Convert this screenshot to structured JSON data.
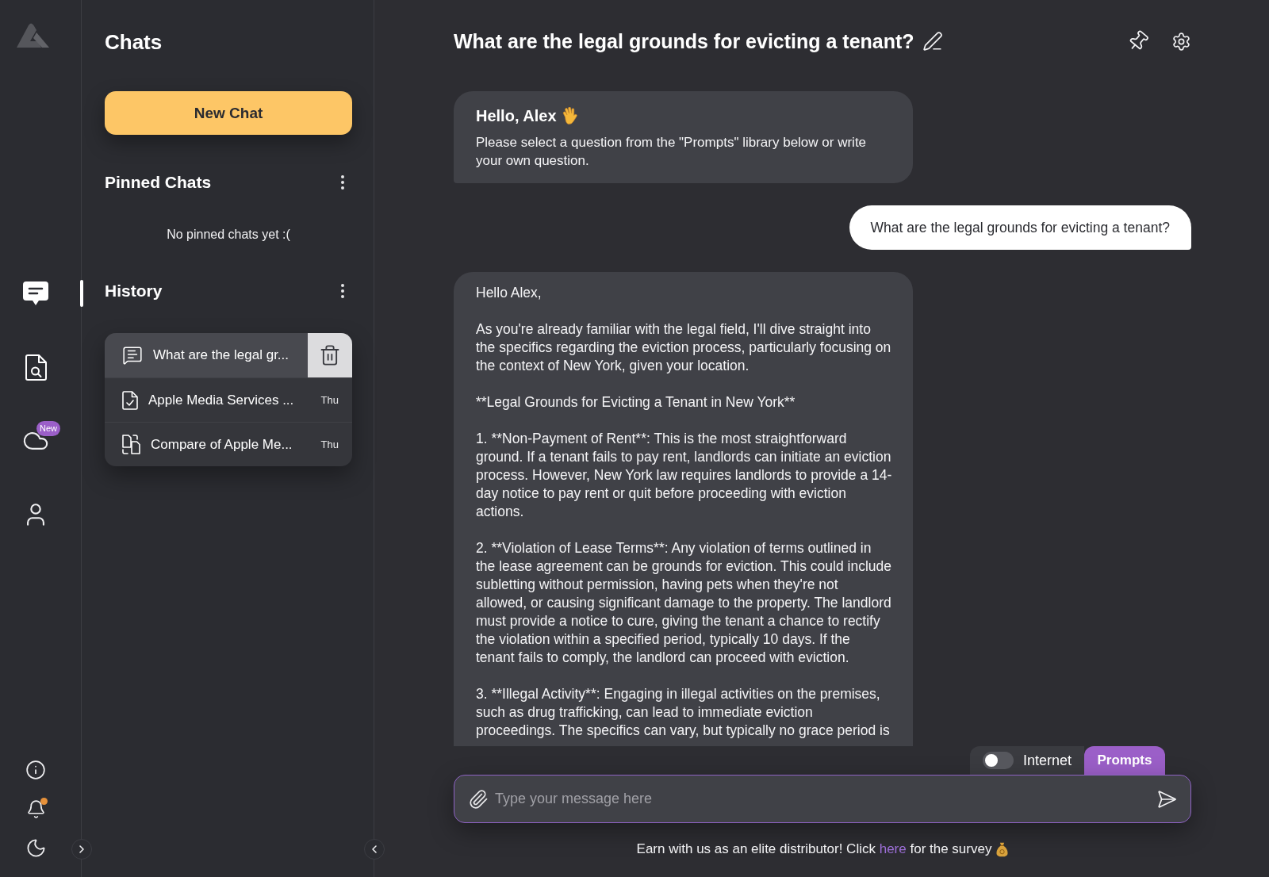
{
  "rail": {
    "nav": [
      {
        "kind": "chats",
        "selected": true
      },
      {
        "kind": "document-search",
        "selected": false
      },
      {
        "kind": "cloud",
        "selected": false,
        "badge": "New"
      },
      {
        "kind": "profile",
        "selected": false
      }
    ],
    "bottom": [
      {
        "kind": "info"
      },
      {
        "kind": "notifications",
        "unread": true
      },
      {
        "kind": "theme"
      }
    ]
  },
  "sidebar": {
    "title": "Chats",
    "new_chat_button": "New Chat",
    "pinned": {
      "heading": "Pinned Chats",
      "empty_text": "No pinned chats yet :("
    },
    "history": {
      "heading": "History",
      "items": [
        {
          "kind": "chat",
          "title": "What are the legal gr...",
          "selected": true
        },
        {
          "kind": "document",
          "title": "Apple Media Services ...",
          "date": "Thu",
          "selected": false
        },
        {
          "kind": "comparison",
          "title": "Compare of Apple Me...",
          "date": "Thu",
          "selected": false
        }
      ]
    }
  },
  "chat": {
    "title": "What are the legal grounds for evicting a tenant?",
    "messages": [
      {
        "kind": "assistant",
        "heading": "Hello, Alex",
        "paragraphs": [
          "Please select a question from the \"Prompts\" library below or write your own question."
        ]
      },
      {
        "kind": "user",
        "paragraphs": [
          "What are the legal grounds for evicting a tenant?"
        ]
      },
      {
        "kind": "assistant",
        "paragraphs": [
          "Hello Alex,",
          "As you're already familiar with the legal field, I'll dive straight into the specifics regarding the eviction process, particularly focusing on the context of New York, given your location.",
          "**Legal Grounds for Evicting a Tenant in New York**",
          "1. **Non-Payment of Rent**: This is the most straightforward ground. If a tenant fails to pay rent, landlords can initiate an eviction process. However, New York law requires landlords to provide a 14-day notice to pay rent or quit before proceeding with eviction actions.",
          "2. **Violation of Lease Terms**: Any violation of terms outlined in the lease agreement can be grounds for eviction. This could include subletting without permission, having pets when they're not allowed, or causing significant damage to the property. The landlord must provide a notice to cure, giving the tenant a chance to rectify the violation within a specified period, typically 10 days. If the tenant fails to comply, the landlord can proceed with eviction.",
          "3. **Illegal Activity**: Engaging in illegal activities on the premises, such as drug trafficking, can lead to immediate eviction proceedings. The specifics can vary, but typically no grace period is"
        ]
      }
    ],
    "composer": {
      "internet": {
        "label": "Internet",
        "on": false
      },
      "prompts_button": "Prompts",
      "placeholder": "Type your message here"
    },
    "footer": {
      "text_before": "Earn with us as an elite distributor! Click",
      "link": "here",
      "text_after": "for the survey"
    }
  }
}
